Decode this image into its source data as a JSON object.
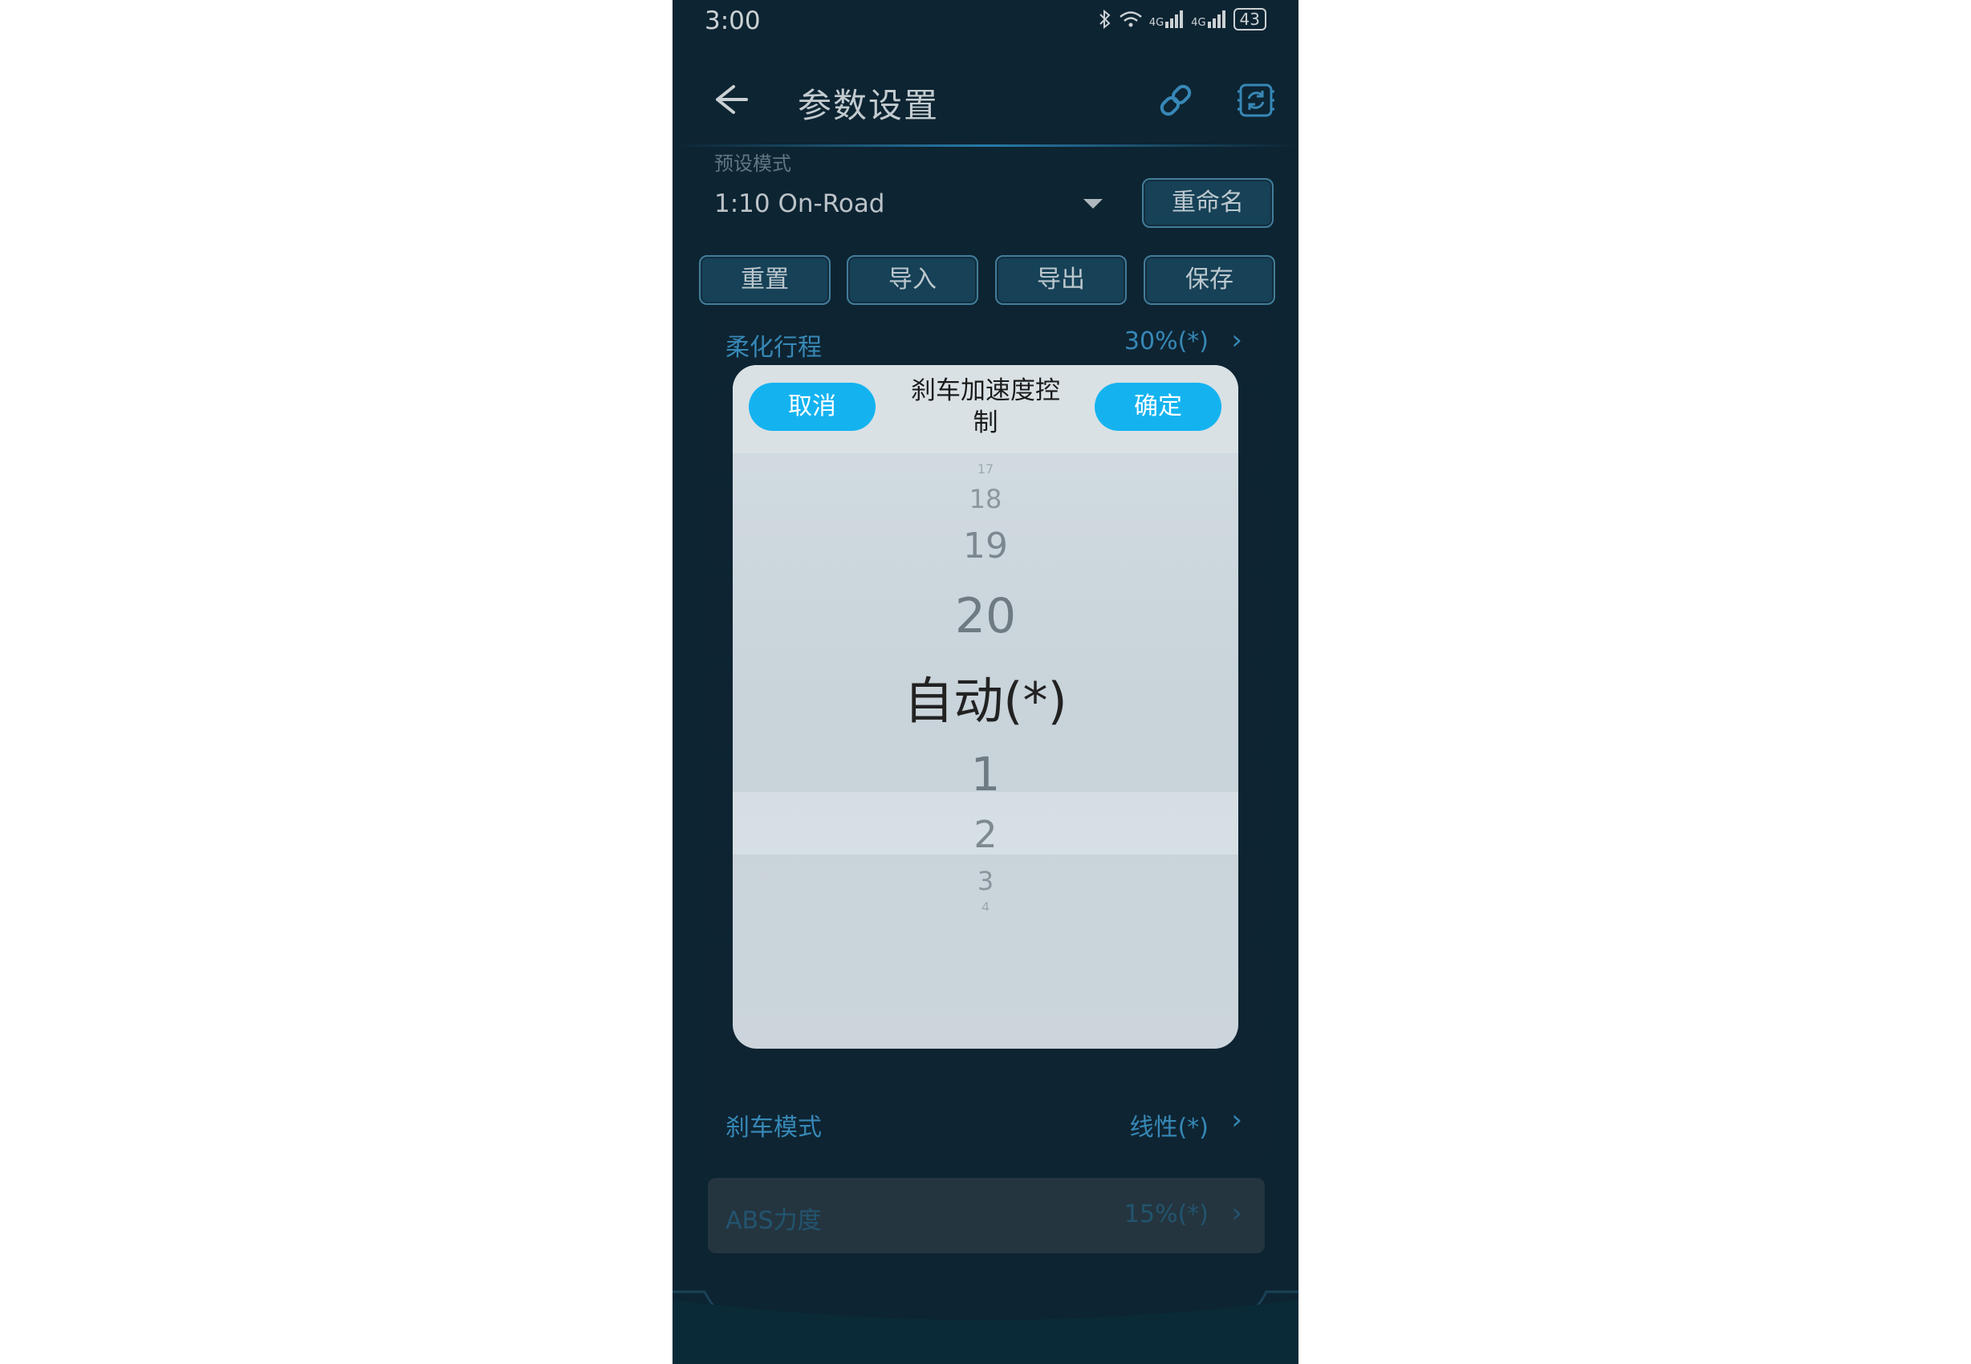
{
  "status_bar": {
    "time": "3:00",
    "icons": [
      "bluetooth-icon",
      "wifi-icon",
      "signal-4g-icon",
      "signal-4g-icon"
    ],
    "network1": "4G",
    "network2": "4G",
    "battery": "43"
  },
  "header": {
    "title": "参数设置",
    "back_icon": "arrow-left-icon",
    "link_icon": "link-icon",
    "sync_icon": "sync-icon"
  },
  "preset": {
    "label": "预设模式",
    "value": "1:10 On-Road",
    "rename_label": "重命名"
  },
  "actions": {
    "reset": "重置",
    "import": "导入",
    "export": "导出",
    "save": "保存"
  },
  "rows": [
    {
      "label": "柔化行程",
      "value": "30%(*)"
    },
    {
      "label": "刹车模式",
      "value": "线性(*)"
    },
    {
      "label": "ABS力度",
      "value": "15%(*)"
    }
  ],
  "modal": {
    "cancel": "取消",
    "confirm": "确定",
    "title_line1": "刹车加速度控",
    "title_line2": "制",
    "options": [
      "17",
      "18",
      "19",
      "20",
      "自动(*)",
      "1",
      "2",
      "3",
      "4"
    ],
    "selected": "自动(*)"
  },
  "colors": {
    "accent": "#14b3f0",
    "background": "#0f2a3a",
    "row_text": "#3f9bd0"
  }
}
